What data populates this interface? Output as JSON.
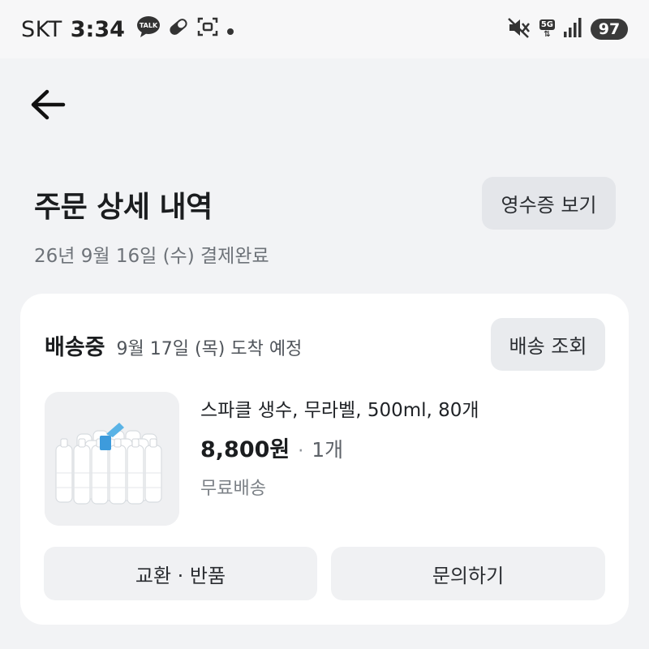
{
  "status_bar": {
    "carrier": "SKT",
    "time": "3:34",
    "notification_icons": [
      "talk-icon",
      "pill-icon",
      "screenshot-icon",
      "dot-icon"
    ],
    "talk_label": "TALK",
    "network": "5G",
    "battery": "97"
  },
  "header": {
    "back_icon": "arrow-left-icon"
  },
  "order": {
    "title": "주문 상세 내역",
    "receipt_button": "영수증 보기",
    "date_status": "26년 9월 16일 (수) 결제완료"
  },
  "shipment": {
    "status": "배송중",
    "eta": "9월 17일 (목) 도착 예정",
    "track_button": "배송 조회",
    "product": {
      "name": "스파클 생수, 무라벨, 500ml, 80개",
      "price": "8,800원",
      "separator": "·",
      "quantity": "1개",
      "shipping": "무료배송"
    },
    "exchange_button": "교환 · 반품",
    "inquiry_button": "문의하기"
  },
  "colors": {
    "page_bg": "#f2f3f5",
    "card_bg": "#ffffff",
    "button_bg": "#e9ebee",
    "text_primary": "#1b1d1f",
    "text_secondary": "#6e7379"
  }
}
